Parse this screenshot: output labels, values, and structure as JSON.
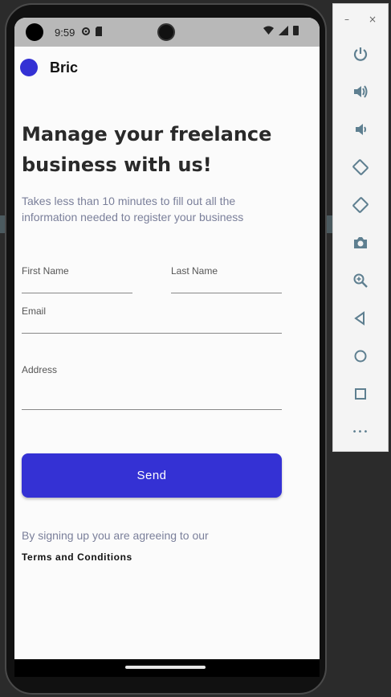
{
  "status": {
    "time": "9:59",
    "icons": [
      "settings-icon",
      "sim-icon",
      "wifi-icon",
      "signal-icon",
      "battery-icon"
    ]
  },
  "app": {
    "brand": "Bric",
    "accent": "#3431d4"
  },
  "form": {
    "heading_line1": "Manage your freelance",
    "heading_line2": "business with us!",
    "subtitle_line1": "Takes less than 10 minutes to fill out all the",
    "subtitle_line2": "information needed to register your business",
    "first_name_label": "First Name",
    "last_name_label": "Last Name",
    "email_label": "Email",
    "address_label": "Address",
    "send_label": "Send",
    "agree_text": "By signing up you are agreeing to our",
    "terms_text": "Terms and Conditions"
  },
  "toolbar": {
    "minimize_glyph": "–",
    "close_glyph": "×",
    "more_glyph": "•••",
    "items": [
      "power-icon",
      "volume-up-icon",
      "volume-down-icon",
      "rotate-left-icon",
      "rotate-right-icon",
      "camera-icon",
      "zoom-icon",
      "back-icon",
      "home-icon",
      "overview-icon",
      "more-icon"
    ]
  }
}
